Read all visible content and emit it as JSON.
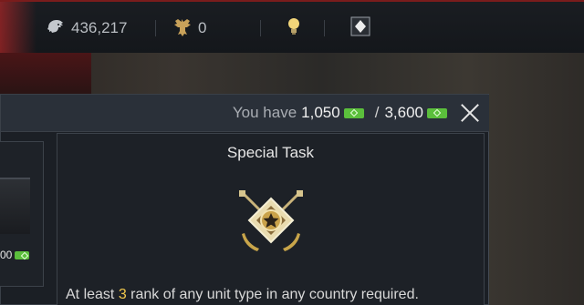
{
  "topbar": {
    "lions": "436,217",
    "eagles": "0",
    "icons": [
      "lion-icon",
      "eagle-icon",
      "lightbulb-icon",
      "premium-diamond-icon"
    ]
  },
  "panel": {
    "you_have_label": "You have",
    "you_have_value": "1,050",
    "target_value": "3,600",
    "slash": "/"
  },
  "left_card": {
    "price": "00"
  },
  "task": {
    "title": "Special Task",
    "req_prefix": "At least",
    "req_number": "3",
    "req_suffix": "rank of any unit type in any country required."
  },
  "colors": {
    "accent_gold": "#f2c94c",
    "gem_green": "#5bbf3c",
    "topbar_red": "#7a1c1c"
  }
}
